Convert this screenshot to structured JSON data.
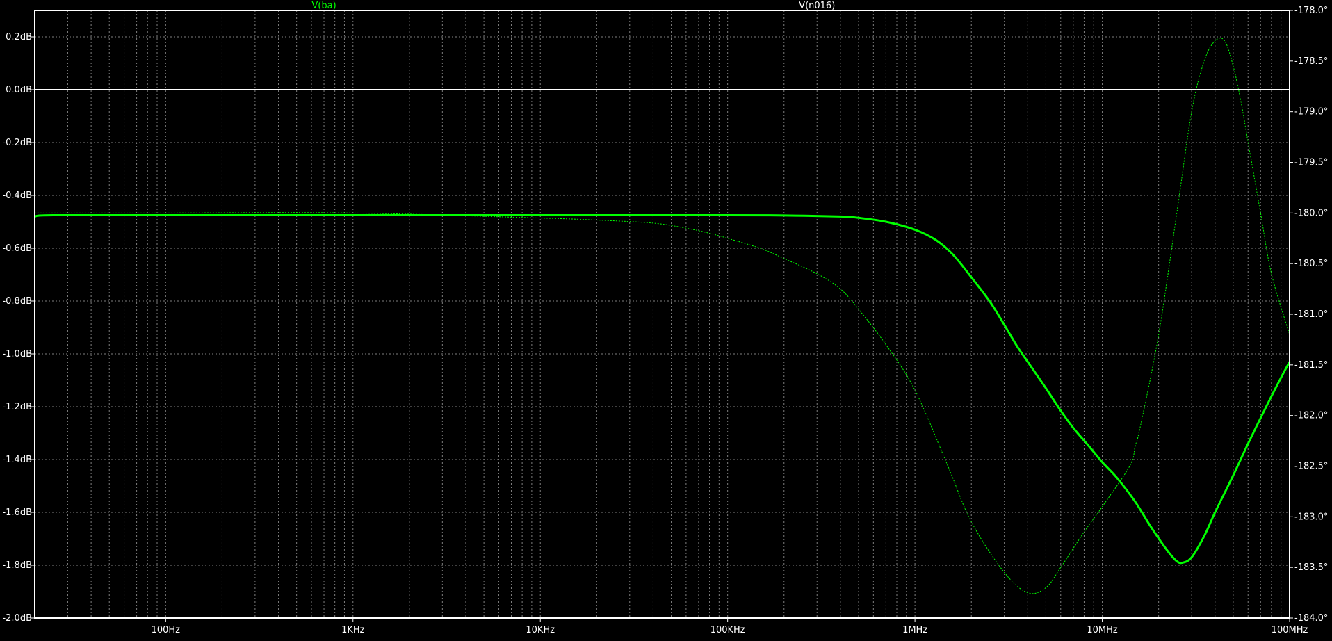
{
  "colors": {
    "background": "#000000",
    "frame": "#ffffff",
    "grid": "#7f7f7f",
    "zero_line": "#ffffff",
    "axis_text": "#ffffff",
    "trace": "#00ff00"
  },
  "chart_data": {
    "type": "line",
    "grid": true,
    "x_scale": "log",
    "x_range_hz": [
      20,
      100000000
    ],
    "y_left_range_db": [
      -2.0,
      0.3
    ],
    "y_right_range_deg": [
      -184.0,
      -178.0
    ],
    "x_ticks": [
      {
        "value": 100,
        "label": "100Hz"
      },
      {
        "value": 1000,
        "label": "1KHz"
      },
      {
        "value": 10000,
        "label": "10KHz"
      },
      {
        "value": 100000,
        "label": "100KHz"
      },
      {
        "value": 1000000,
        "label": "1MHz"
      },
      {
        "value": 10000000,
        "label": "10MHz"
      },
      {
        "value": 100000000,
        "label": "100MHz"
      }
    ],
    "y_left_ticks": [
      {
        "value": 0.2,
        "label": "0.2dB"
      },
      {
        "value": 0.0,
        "label": "0.0dB"
      },
      {
        "value": -0.2,
        "label": "-0.2dB"
      },
      {
        "value": -0.4,
        "label": "-0.4dB"
      },
      {
        "value": -0.6,
        "label": "-0.6dB"
      },
      {
        "value": -0.8,
        "label": "-0.8dB"
      },
      {
        "value": -1.0,
        "label": "-1.0dB"
      },
      {
        "value": -1.2,
        "label": "-1.2dB"
      },
      {
        "value": -1.4,
        "label": "-1.4dB"
      },
      {
        "value": -1.6,
        "label": "-1.6dB"
      },
      {
        "value": -1.8,
        "label": "-1.8dB"
      },
      {
        "value": -2.0,
        "label": "-2.0dB"
      }
    ],
    "y_right_ticks": [
      {
        "value": -178.0,
        "label": "-178.0°"
      },
      {
        "value": -178.5,
        "label": "-178.5°"
      },
      {
        "value": -179.0,
        "label": "-179.0°"
      },
      {
        "value": -179.5,
        "label": "-179.5°"
      },
      {
        "value": -180.0,
        "label": "-180.0°"
      },
      {
        "value": -180.5,
        "label": "-180.5°"
      },
      {
        "value": -181.0,
        "label": "-181.0°"
      },
      {
        "value": -181.5,
        "label": "-181.5°"
      },
      {
        "value": -182.0,
        "label": "-182.0°"
      },
      {
        "value": -182.5,
        "label": "-182.5°"
      },
      {
        "value": -183.0,
        "label": "-183.0°"
      },
      {
        "value": -183.5,
        "label": "-183.5°"
      },
      {
        "value": -184.0,
        "label": "-184.0°"
      }
    ],
    "trace_labels": [
      {
        "name": "V(ba)",
        "color": "#00ff00"
      },
      {
        "name": "V(n016)",
        "color": "#ffffff"
      }
    ],
    "series": [
      {
        "kind": "magnitude",
        "axis": "left",
        "style": "solid",
        "x": [
          20,
          25,
          100,
          1000,
          10000,
          100000,
          200000,
          400000,
          500000,
          700000,
          1000000,
          1300000,
          1600000,
          2000000,
          2500000,
          3000000,
          3500000,
          4000000,
          5000000,
          6000000,
          7000000,
          8500000,
          10000000,
          12000000,
          15000000,
          18000000,
          22000000,
          25000000,
          27000000,
          30000000,
          35000000,
          40000000,
          50000000,
          60000000,
          75000000,
          90000000,
          100000000
        ],
        "y": [
          -0.48,
          -0.475,
          -0.475,
          -0.475,
          -0.475,
          -0.475,
          -0.476,
          -0.48,
          -0.485,
          -0.5,
          -0.53,
          -0.57,
          -0.625,
          -0.71,
          -0.8,
          -0.89,
          -0.97,
          -1.03,
          -1.13,
          -1.215,
          -1.28,
          -1.35,
          -1.41,
          -1.47,
          -1.56,
          -1.65,
          -1.74,
          -1.785,
          -1.79,
          -1.77,
          -1.69,
          -1.6,
          -1.46,
          -1.34,
          -1.2,
          -1.09,
          -1.03
        ]
      },
      {
        "kind": "phase",
        "axis": "right",
        "style": "dotted",
        "x": [
          20,
          100,
          1000,
          10000,
          20000,
          40000,
          60000,
          80000,
          100000,
          150000,
          200000,
          300000,
          400000,
          500000,
          700000,
          1000000,
          1500000,
          2000000,
          3000000,
          4000000,
          5000000,
          6000000,
          8000000,
          10000000,
          14000000,
          15000000,
          16000000,
          20000000,
          25000000,
          30000000,
          35000000,
          40000000,
          45000000,
          50000000,
          55000000,
          60000000,
          70000000,
          80000000,
          100000000
        ],
        "y": [
          -180.0,
          -180.0,
          -180.0,
          -180.05,
          -180.07,
          -180.1,
          -180.15,
          -180.2,
          -180.25,
          -180.35,
          -180.45,
          -180.6,
          -180.75,
          -180.95,
          -181.3,
          -181.75,
          -182.5,
          -183.05,
          -183.55,
          -183.75,
          -183.7,
          -183.5,
          -183.15,
          -182.9,
          -182.5,
          -182.3,
          -182.1,
          -181.2,
          -180.0,
          -179.0,
          -178.5,
          -178.3,
          -178.3,
          -178.55,
          -178.9,
          -179.3,
          -180.0,
          -180.6,
          -181.2
        ]
      }
    ]
  }
}
